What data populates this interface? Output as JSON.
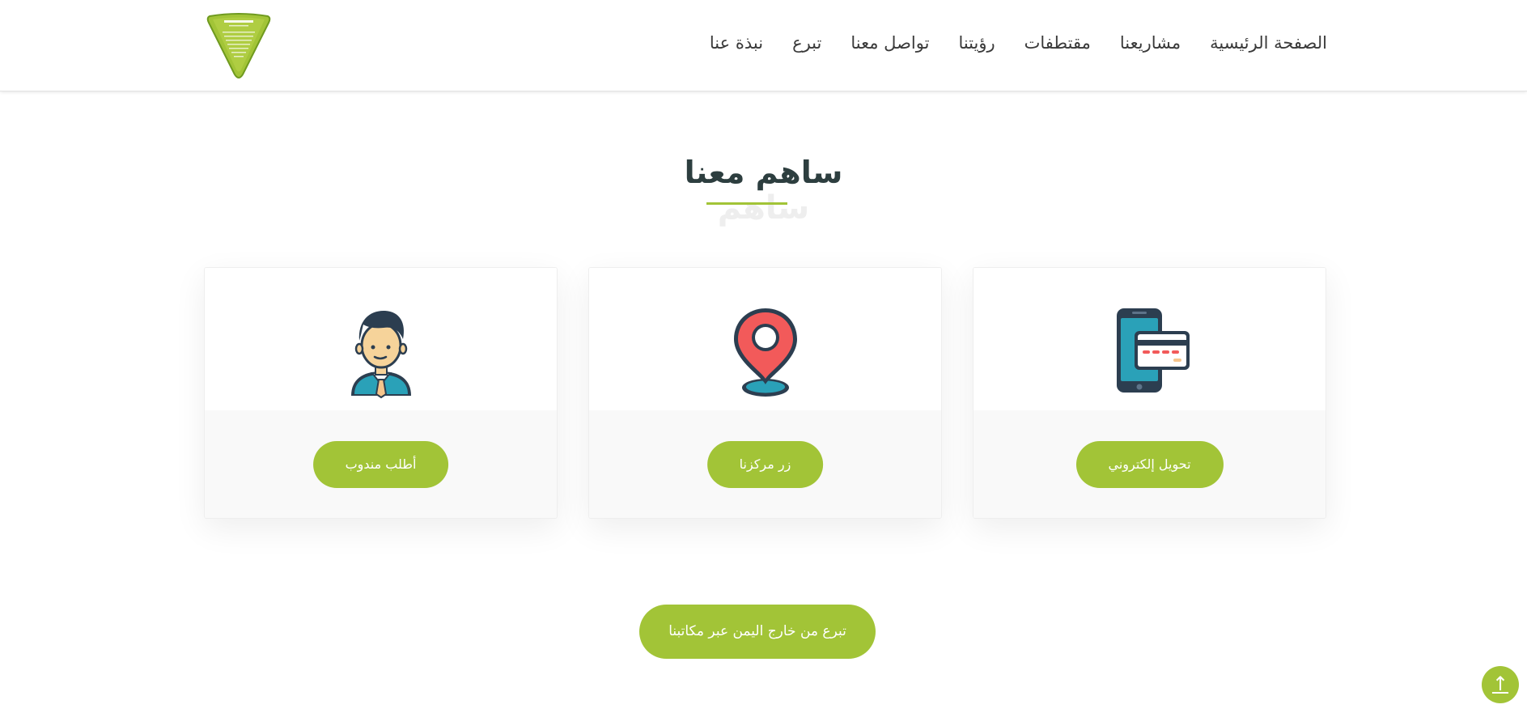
{
  "colors": {
    "accent": "#a2c437",
    "heading": "#2d3e3f",
    "nav_text": "#3a3a3a"
  },
  "header": {
    "logo_icon": "triangle-logo-icon",
    "nav": [
      {
        "label": "الصفحة الرئيسية"
      },
      {
        "label": "مشاريعنا"
      },
      {
        "label": "مقتطفات"
      },
      {
        "label": "رؤيتنا"
      },
      {
        "label": "تواصل معنا"
      },
      {
        "label": "تبرع"
      },
      {
        "label": "نبذة عنا"
      }
    ]
  },
  "section": {
    "title": "ساهم معنا",
    "ghost_title": "ساهم"
  },
  "cards": [
    {
      "icon": "mobile-payment-icon",
      "button_label": "تحويل إلكتروني"
    },
    {
      "icon": "location-pin-icon",
      "button_label": "زر مركزنا"
    },
    {
      "icon": "representative-person-icon",
      "button_label": "أطلب مندوب"
    }
  ],
  "abroad_button": {
    "label": "تبرع من خارج اليمن عبر مكاتبنا"
  },
  "scroll_top": {
    "icon": "arrow-up-icon",
    "glyph": "↑"
  }
}
